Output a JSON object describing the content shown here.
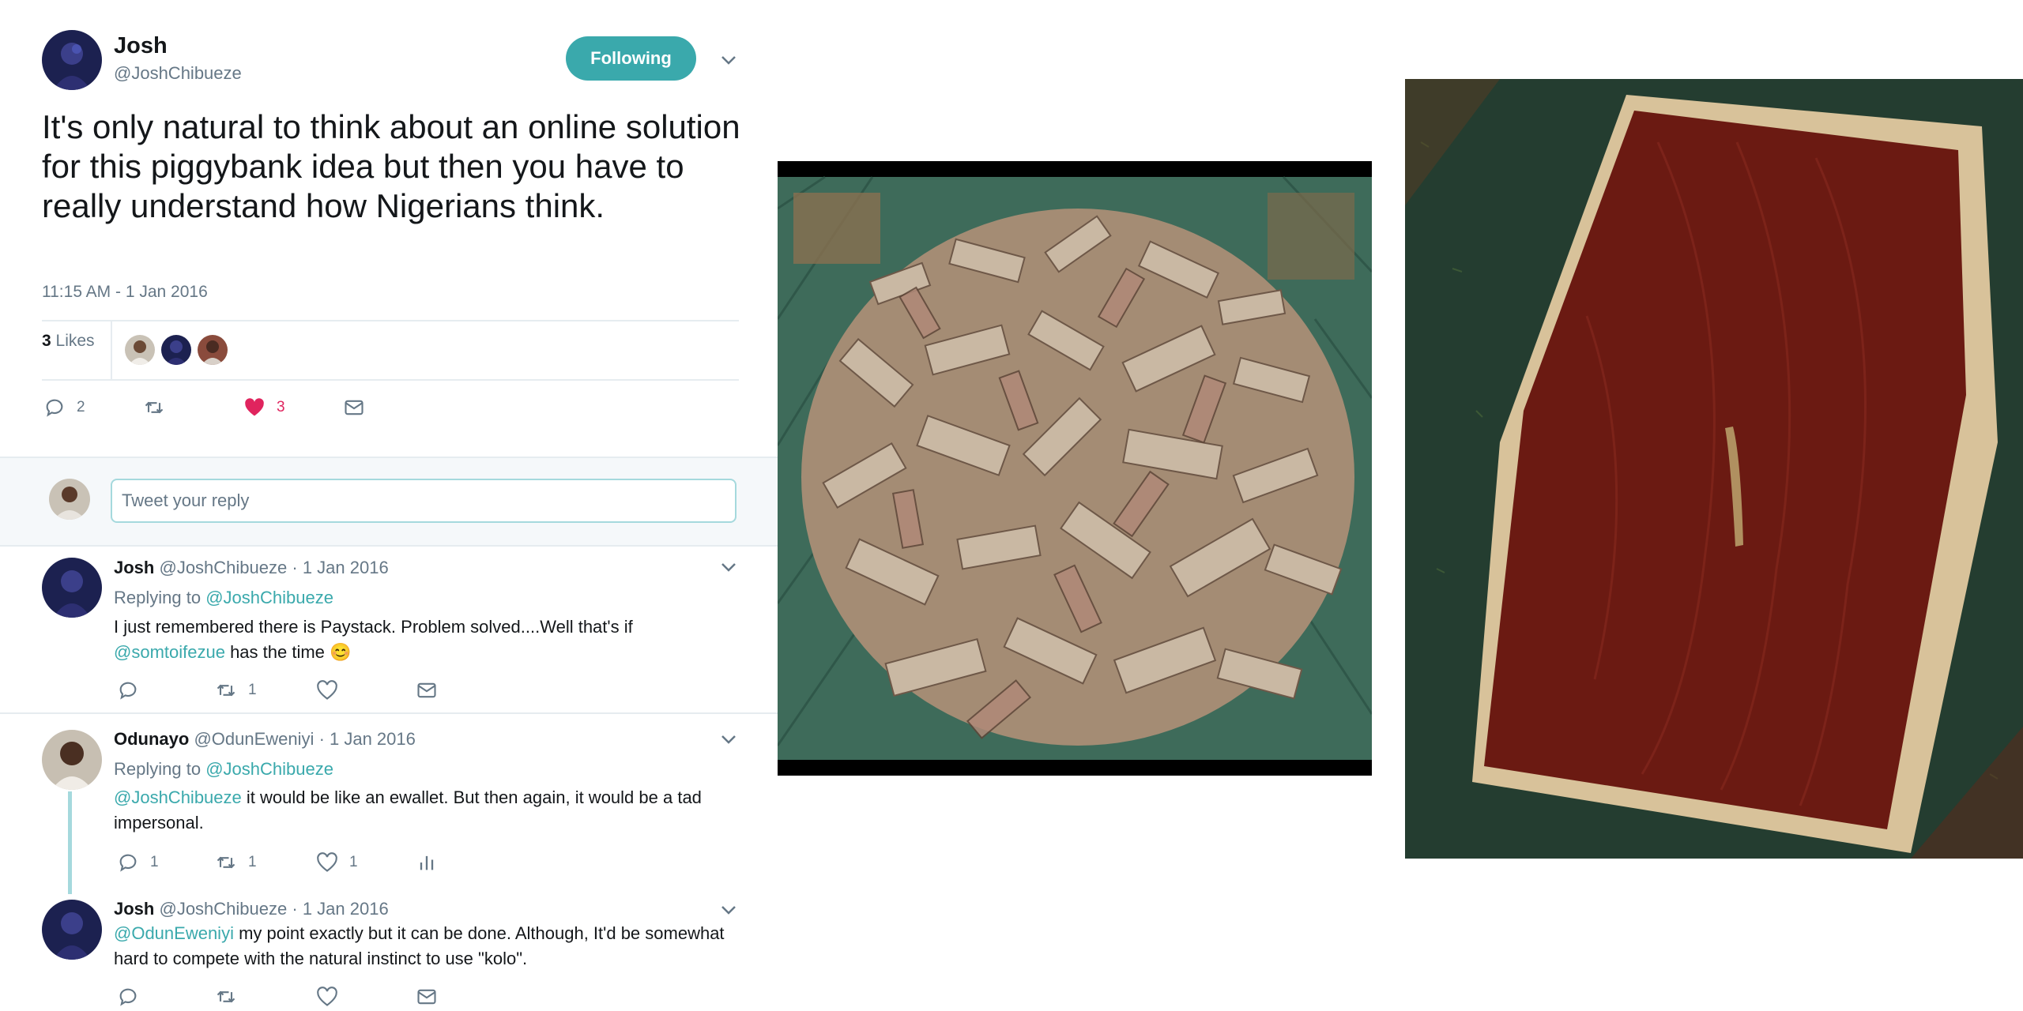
{
  "tweet": {
    "author_name": "Josh",
    "author_handle": "@JoshChibueze",
    "follow_label": "Following",
    "text": "It's only natural to think about an online solution for this piggybank idea but then you have to really understand how Nigerians think.",
    "timestamp": "11:15 AM - 1 Jan 2016",
    "likes_count": "3",
    "likes_label": "Likes",
    "actions": {
      "reply_count": "2",
      "retweet_count": "",
      "like_count": "3"
    }
  },
  "reply_box": {
    "placeholder": "Tweet your reply"
  },
  "replies": [
    {
      "name": "Josh",
      "handle": "@JoshChibueze",
      "date": "· 1 Jan 2016",
      "replying_prefix": "Replying to",
      "replying_to": "@JoshChibueze",
      "text_part1": "I just remembered there is Paystack. Problem solved....Well that's if",
      "mention": "@somtoifezue",
      "text_part2": " has the time",
      "emoji": "😊",
      "reply_count": "",
      "retweet_count": "1",
      "like_count": ""
    },
    {
      "name": "Odunayo",
      "handle": "@OdunEweniyi",
      "date": "· 1 Jan 2016",
      "replying_prefix": "Replying to",
      "replying_to": "@JoshChibueze",
      "mention": "@JoshChibueze",
      "text_part1": " it would be like an ewallet. But then again, it would be a tad impersonal.",
      "reply_count": "1",
      "retweet_count": "1",
      "like_count": "1"
    },
    {
      "name": "Josh",
      "handle": "@JoshChibueze",
      "date": "· 1 Jan 2016",
      "mention": "@OdunEweniyi",
      "text_part1": " my point exactly but it can be done. Although, It'd be somewhat hard to compete with the natural instinct to use \"kolo\"."
    }
  ],
  "colors": {
    "accent": "#3aa9ac",
    "like_red": "#e0245e",
    "muted": "#657786",
    "text": "#14171a"
  },
  "icons": [
    "reply-icon",
    "retweet-icon",
    "heart-icon",
    "mail-icon",
    "analytics-icon",
    "chevron-down-icon"
  ]
}
